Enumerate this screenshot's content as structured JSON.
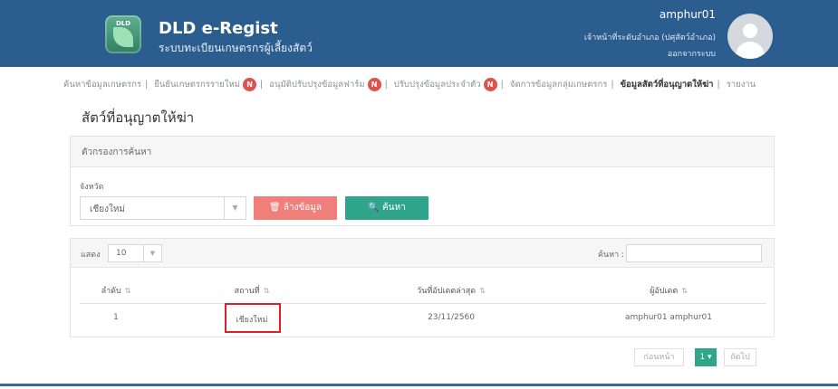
{
  "header": {
    "logo_text": "DLD",
    "title": "DLD e-Regist",
    "subtitle": "ระบบทะเบียนเกษตรกรผู้เลี้ยงสัตว์",
    "user_name": "amphur01",
    "user_role": "เจ้าหน้าที่ระดับอำเภอ (ปศุสัตว์อำเภอ)",
    "logout": "ออกจากระบบ"
  },
  "nav": {
    "items": [
      {
        "label": "ค้นหาข้อมูลเกษตรกร",
        "badge": ""
      },
      {
        "label": "ยืนยันเกษตรกรรายใหม่",
        "badge": "N"
      },
      {
        "label": "อนุมัติปรับปรุงข้อมูลฟาร์ม",
        "badge": "N"
      },
      {
        "label": "ปรับปรุงข้อมูลประจำตัว",
        "badge": "N"
      },
      {
        "label": "จัดการข้อมูลกลุ่มเกษตรกร",
        "badge": ""
      },
      {
        "label": "ข้อมูลสัตว์ที่อนุญาตให้ฆ่า",
        "badge": ""
      },
      {
        "label": "รายงาน",
        "badge": ""
      }
    ]
  },
  "page": {
    "title": "สัตว์ที่อนุญาตให้ฆ่า"
  },
  "filter": {
    "heading": "ตัวกรองการค้นหา",
    "province_label": "จังหวัด",
    "province_value": "เชียงใหม่",
    "clear_button": "ล้างข้อมูล",
    "search_button": "ค้นหา"
  },
  "table": {
    "show_label": "แสดง",
    "page_length": "10",
    "search_label": "ค้นหา :",
    "columns": [
      "ลำดับ",
      "สถานที่",
      "วันที่อัปเดตล่าสุด",
      "ผู้อัปเดต"
    ],
    "rows": [
      [
        "1",
        "เชียงใหม่",
        "23/11/2560",
        "amphur01 amphur01"
      ]
    ]
  },
  "pagination": {
    "prev": "ก่อนหน้า",
    "current": "1",
    "next": "ถัดไป"
  },
  "colors": {
    "header_bg": "#2b5d8f",
    "clear_button": "#f07f7c",
    "search_button": "#2fa58b",
    "badge": "#d9534f",
    "highlight_box": "#e11f25"
  }
}
